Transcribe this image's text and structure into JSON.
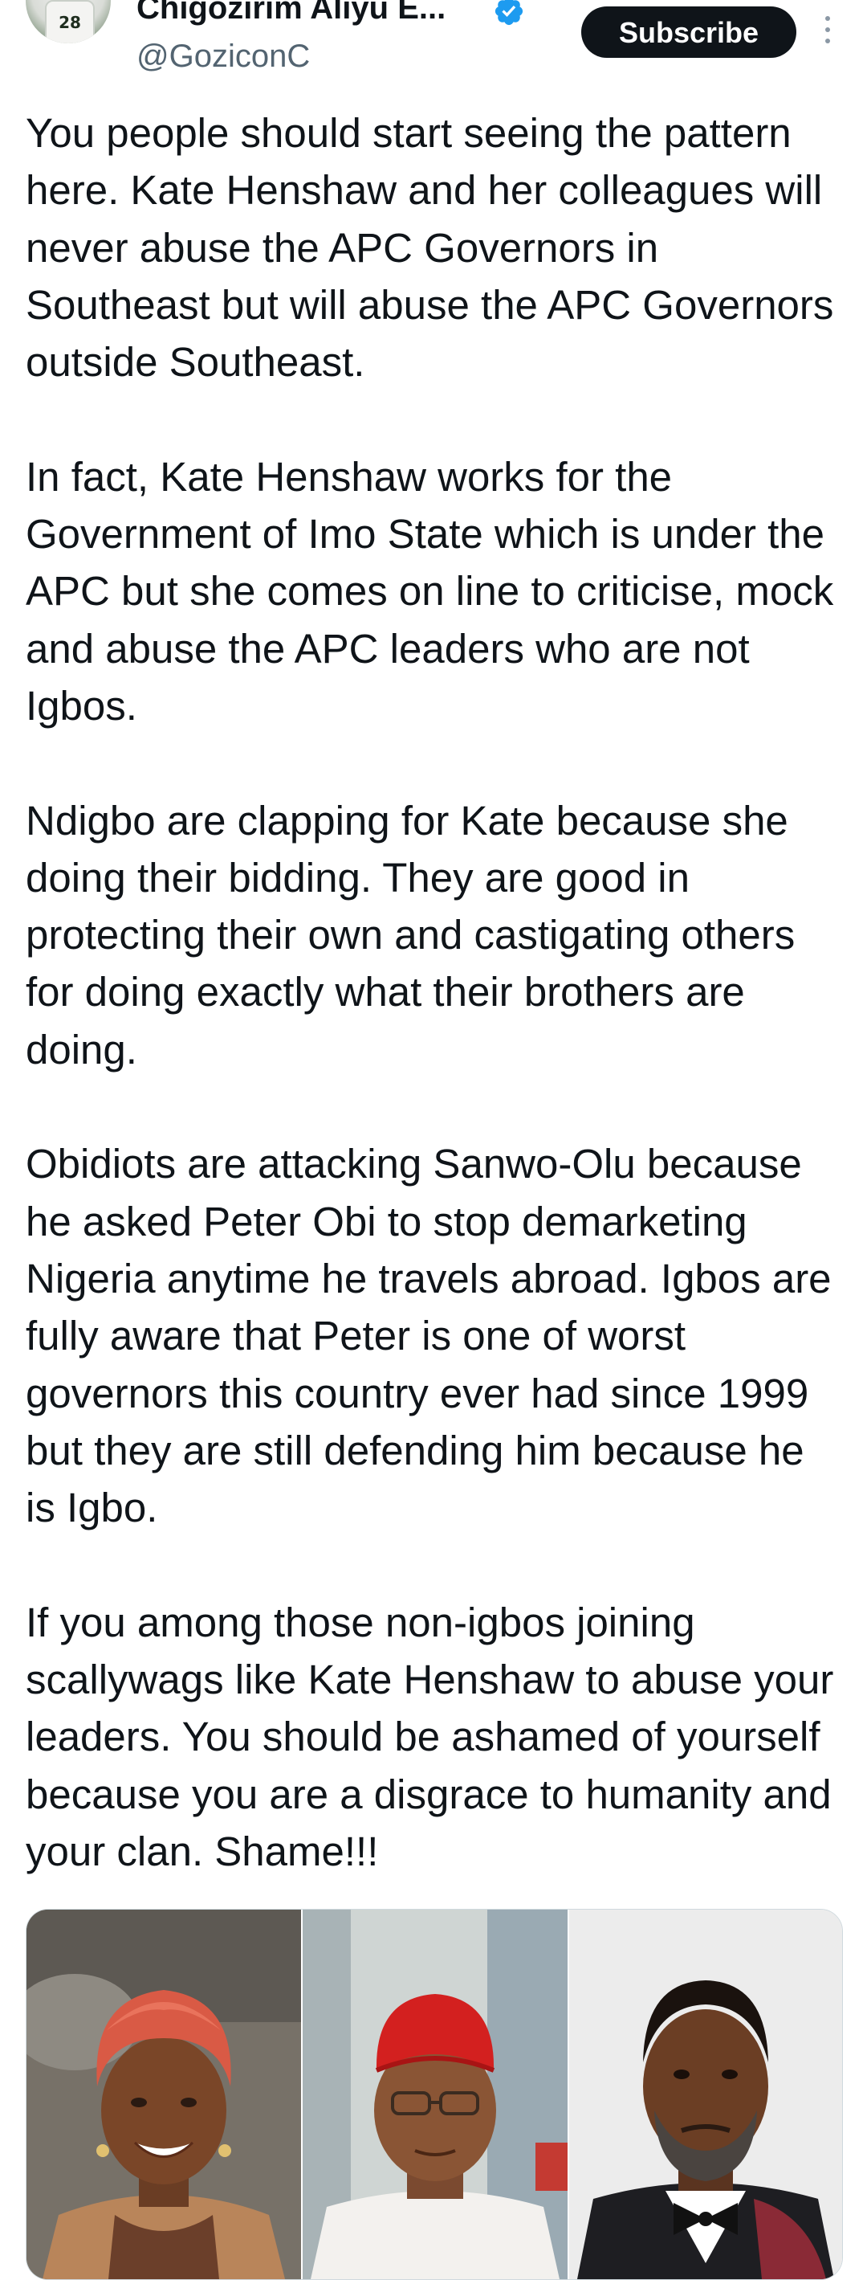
{
  "header": {
    "display_name": "Chigozirim Aliyu E...",
    "handle": "@GoziconC",
    "subscribe_label": "Subscribe",
    "avatar_jersey_number": "28",
    "verified_color": "#1d9bf0"
  },
  "tweet": {
    "paragraphs": [
      "You people should start seeing the pattern here. Kate Henshaw and her colleagues will never abuse the APC Governors in Southeast but will abuse the APC Governors outside Southeast.",
      "In fact, Kate Henshaw works for the Government of Imo State which is under the APC but she comes on line to criticise, mock and abuse the APC leaders who are not Igbos.",
      "Ndigbo are clapping for Kate because she doing their bidding. They are good in protecting their own and castigating others for doing exactly what their brothers are doing.",
      "Obidiots are attacking Sanwo-Olu because he asked Peter Obi to stop demarketing Nigeria anytime he travels abroad. Igbos are fully aware that Peter is one of worst governors this country ever had since 1999 but they are still defending him because he is Igbo.",
      "If you among those non-igbos joining scallywags like Kate Henshaw to abuse your leaders. You should be ashamed of yourself because you are a disgrace to humanity and your clan. Shame!!!"
    ]
  },
  "media": {
    "icons": [
      "woman-red-headwrap-photo",
      "man-red-cap-photo",
      "man-suit-bowtie-photo"
    ]
  }
}
